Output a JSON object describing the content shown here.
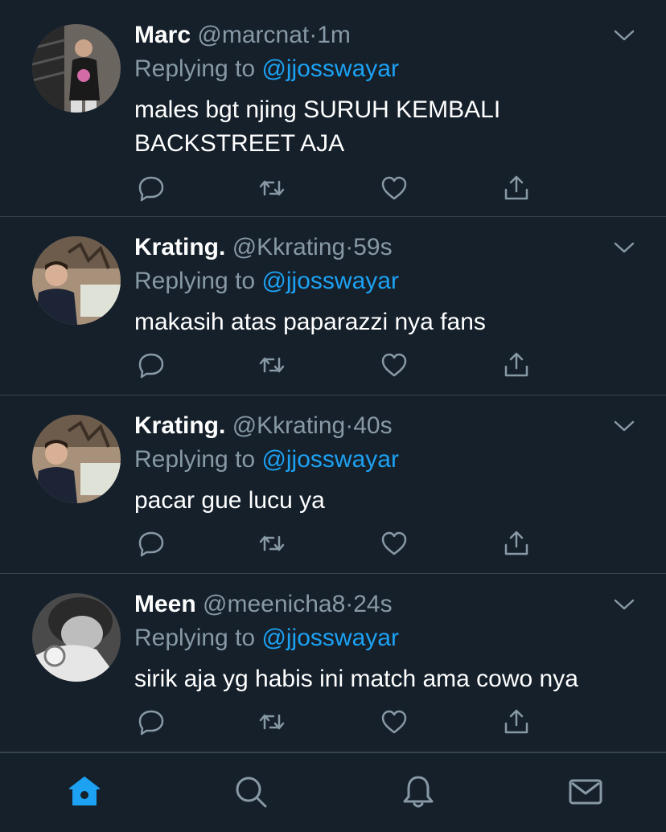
{
  "tweets": [
    {
      "name": "Marc",
      "handle": "@marcnat",
      "time": "1m",
      "replying_prefix": "Replying to",
      "replying_to": "@jjosswayar",
      "text": "males bgt njing SURUH KEMBALI BACKSTREET AJA"
    },
    {
      "name": "Krating.",
      "handle": "@Kkrating",
      "time": "59s",
      "replying_prefix": "Replying to",
      "replying_to": "@jjosswayar",
      "text": "makasih atas paparazzi nya fans"
    },
    {
      "name": "Krating.",
      "handle": "@Kkrating",
      "time": "40s",
      "replying_prefix": "Replying to",
      "replying_to": "@jjosswayar",
      "text": "pacar gue lucu ya"
    },
    {
      "name": "Meen",
      "handle": "@meenicha8",
      "time": "24s",
      "replying_prefix": "Replying to",
      "replying_to": "@jjosswayar",
      "text": "sirik aja yg habis ini match ama cowo nya"
    }
  ],
  "separator": "·",
  "action_icons": [
    "reply-icon",
    "retweet-icon",
    "like-icon",
    "share-icon"
  ],
  "tabbar": {
    "items": [
      "home-icon",
      "search-icon",
      "notifications-icon",
      "messages-icon"
    ],
    "active": "home-icon"
  },
  "colors": {
    "background": "#15202b",
    "divider": "#38444d",
    "secondary_text": "#8899a6",
    "accent": "#1da1f2"
  }
}
